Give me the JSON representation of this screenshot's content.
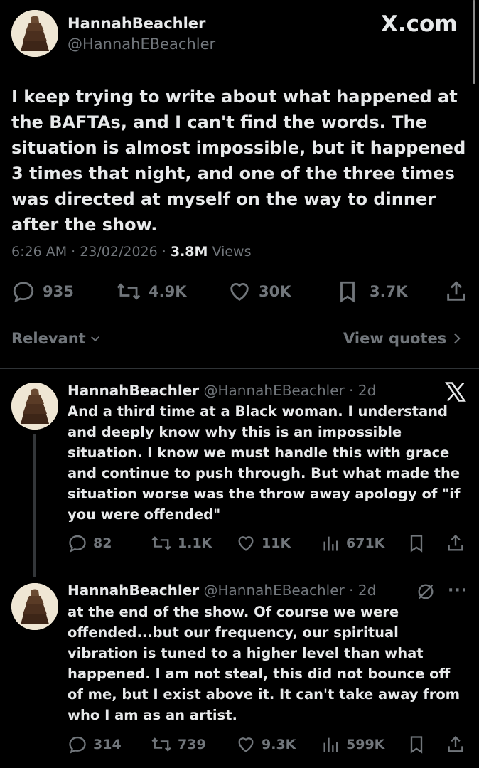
{
  "main": {
    "author_name": "HannahBeachler",
    "author_handle": "@HannahEBeachler",
    "brand": "X.com",
    "text": "I keep trying to write about what happened at the BAFTAs, and I can't find the words.  The situation is almost impossible, but it happened 3 times that night, and one of the three times was directed at myself on the way to dinner after the show.",
    "time": "6:26 AM · 23/02/2026 ·",
    "views_count": "3.8M",
    "views_label": "Views",
    "replies": "935",
    "reposts": "4.9K",
    "likes": "30K",
    "bookmarks": "3.7K"
  },
  "sort": {
    "label": "Relevant",
    "view_quotes": "View quotes"
  },
  "replies": [
    {
      "name": "HannahBeachler",
      "handle": "@HannahEBeachler",
      "age": "· 2d",
      "text": "And a third time at a Black woman.  I understand and deeply know why this is an impossible situation.  I know we must handle this with grace and continue to push through.  But what made the situation worse was the throw away apology of \"if you were offended\"",
      "replies": "82",
      "reposts": "1.1K",
      "likes": "11K",
      "views": "671K"
    },
    {
      "name": "HannahBeachler",
      "handle": "@HannahEBeachler",
      "age": "· 2d",
      "text": "at the end of the show.  Of course we were offended...but our frequency, our spiritual vibration is tuned to a higher level than what happened.  I am not steal, this did not bounce off of me, but I exist above it. It can't take away from who I am as an artist.",
      "replies": "314",
      "reposts": "739",
      "likes": "9.3K",
      "views": "599K"
    }
  ],
  "colors": {
    "background": "#000000",
    "text": "#e7e9ea",
    "muted": "#71767b",
    "divider": "#2f3336"
  }
}
